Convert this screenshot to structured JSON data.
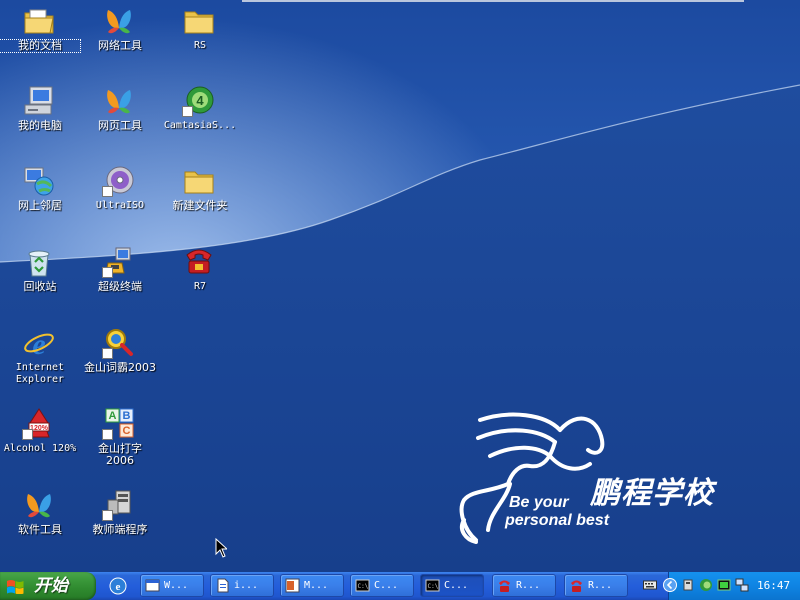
{
  "desktop": {
    "icons": [
      {
        "label": "我的文档"
      },
      {
        "label": "我的电脑"
      },
      {
        "label": "网上邻居"
      },
      {
        "label": "回收站"
      },
      {
        "label": "Internet\nExplorer"
      },
      {
        "label": "Alcohol 120%"
      },
      {
        "label": "软件工具"
      },
      {
        "label": "网络工具"
      },
      {
        "label": "网页工具"
      },
      {
        "label": "UltraISO"
      },
      {
        "label": "超级终端"
      },
      {
        "label": "金山词霸2003"
      },
      {
        "label": "金山打字\n2006"
      },
      {
        "label": "教师端程序"
      },
      {
        "label": "RS"
      },
      {
        "label": "CamtasiaS..."
      },
      {
        "label": "新建文件夹"
      },
      {
        "label": "R7"
      }
    ],
    "logo": {
      "name_cn": "鹏程学校",
      "tagline_line1": "Be your",
      "tagline_line2": "personal best"
    }
  },
  "taskbar": {
    "start_label": "开始",
    "buttons": [
      {
        "label": "W..."
      },
      {
        "label": "i..."
      },
      {
        "label": "M..."
      },
      {
        "label": "C..."
      },
      {
        "label": "C..."
      },
      {
        "label": "R..."
      },
      {
        "label": "R..."
      }
    ],
    "clock": "16:47"
  },
  "colors": {
    "desktop_dark_blue": "#1f4a9b",
    "desktop_light_blue": "#3b6fc4",
    "taskbar_blue": "#245edb",
    "start_green": "#3c9a3c",
    "tray_blue": "#0f84e3"
  }
}
